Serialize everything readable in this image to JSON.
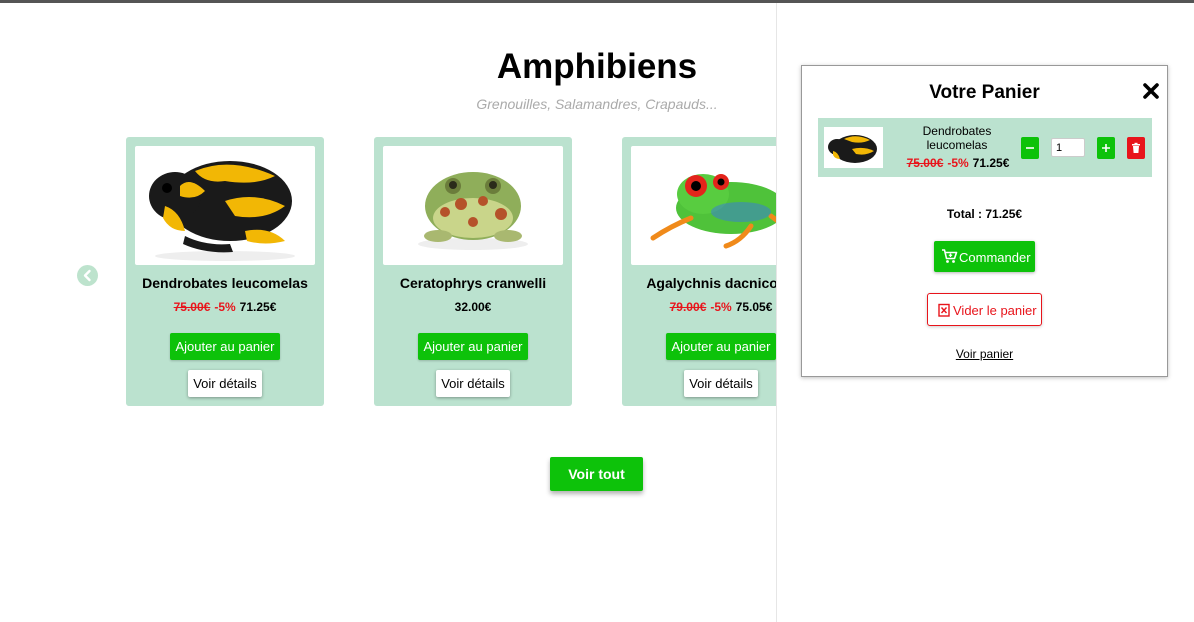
{
  "section": {
    "title": "Amphibiens",
    "subtitle": "Grenouilles, Salamandres, Crapauds..."
  },
  "products": [
    {
      "name": "Dendrobates leucomelas",
      "old_price": "75.00€",
      "discount": "-5%",
      "price": "71.25€",
      "add_label": "Ajouter au panier",
      "details_label": "Voir détails",
      "image_icon": "yellow-black-frog"
    },
    {
      "name": "Ceratophrys cranwelli",
      "old_price": "",
      "discount": "",
      "price": "32.00€",
      "add_label": "Ajouter au panier",
      "details_label": "Voir détails",
      "image_icon": "horned-frog"
    },
    {
      "name": "Agalychnis dacnicolor",
      "old_price": "79.00€",
      "discount": "-5%",
      "price": "75.05€",
      "add_label": "Ajouter au panier",
      "details_label": "Voir détails",
      "image_icon": "red-eyed-tree-frog"
    }
  ],
  "voir_tout_label": "Voir tout",
  "cart": {
    "title": "Votre Panier",
    "items": [
      {
        "name": "Dendrobates leucomelas",
        "old_price": "75.00€",
        "discount": "-5%",
        "price": "71.25€",
        "quantity": "1"
      }
    ],
    "total_label": "Total : 71.25€",
    "commander_label": "Commander",
    "vider_label": "Vider le panier",
    "voir_panier_label": "Voir panier"
  },
  "colors": {
    "card_bg": "#bbe2cf",
    "primary_green": "#0dc20a",
    "danger_red": "#e8141b"
  }
}
